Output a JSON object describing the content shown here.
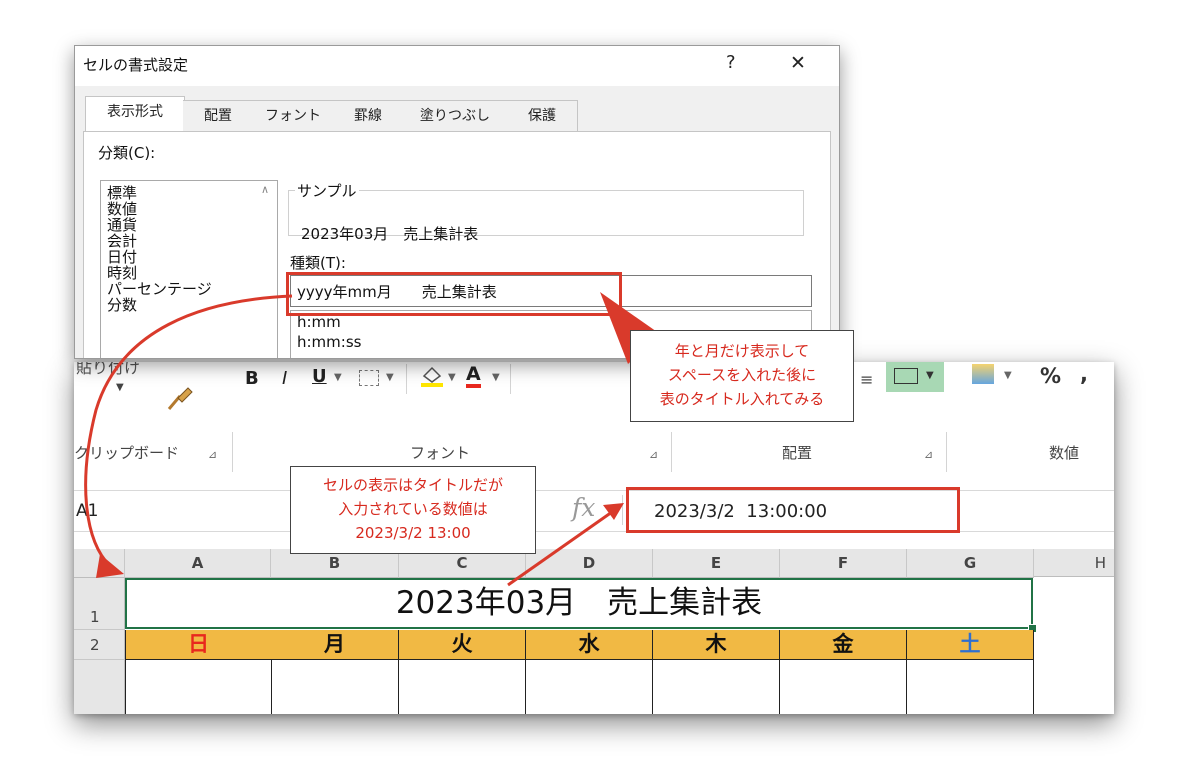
{
  "dialog": {
    "title": "セルの書式設定",
    "help": "?",
    "close": "✕",
    "tabs": [
      "表示形式",
      "配置",
      "フォント",
      "罫線",
      "塗りつぶし",
      "保護"
    ],
    "category_label": "分類(C):",
    "category_accesskey": "C",
    "categories": [
      "標準",
      "数値",
      "通貨",
      "会計",
      "日付",
      "時刻",
      "パーセンテージ",
      "分数"
    ],
    "sample_label": "サンプル",
    "sample_value": "2023年03月　売上集計表",
    "type_label": "種類(T):",
    "type_input": "yyyy年mm月　　売上集計表",
    "type_list": [
      "h:mm",
      "h:mm:ss"
    ]
  },
  "excel": {
    "clipboard_label": "クリップボード",
    "font_group": "フォント",
    "align_group": "配置",
    "number_group": "数値",
    "paste_label": "貼り付け",
    "bold": "B",
    "italic": "I",
    "underline": "U",
    "font_color": "A",
    "percent": "%",
    "comma": ",",
    "name_box": "A1",
    "fx": "fx",
    "formula_value": "2023/3/2  13:00:00",
    "columns": [
      "A",
      "B",
      "C",
      "D",
      "E",
      "F",
      "G",
      "H"
    ],
    "rows": [
      "1",
      "2"
    ],
    "a1_value": "2023年03月　売上集計表",
    "days": [
      "日",
      "月",
      "火",
      "水",
      "木",
      "金",
      "土"
    ],
    "colors": {
      "header_fill": "#f1b944",
      "sunday": "#e8281e",
      "saturday": "#2f6fd1",
      "selection": "#217346"
    }
  },
  "callouts": {
    "right": [
      "年と月だけ表示して",
      "スペースを入れた後に",
      "表のタイトル入れてみる"
    ],
    "middle": [
      "セルの表示はタイトルだが",
      "入力されている数値は",
      "2023/3/2 13:00"
    ]
  }
}
